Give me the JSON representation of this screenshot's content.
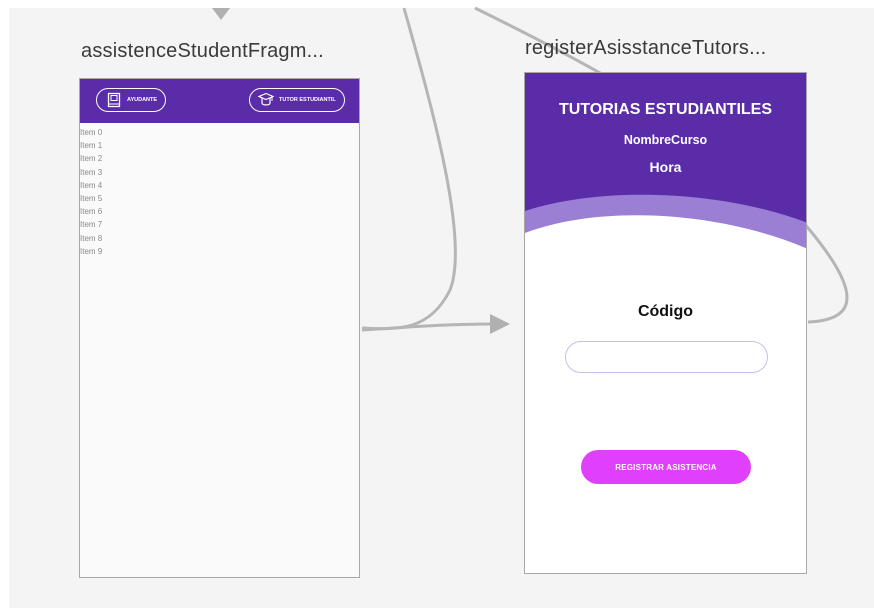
{
  "screens": [
    {
      "title": "assistenceStudentFragm...",
      "buttons": {
        "ayudante": "AYUDANTE",
        "tutor": "TUTOR ESTUDIANTIL"
      },
      "list_items": [
        "Item 0",
        "Item 1",
        "Item 2",
        "Item 3",
        "Item 4",
        "Item 5",
        "Item 6",
        "Item 7",
        "Item 8",
        "Item 9"
      ]
    },
    {
      "title": "registerAsisstanceTutors...",
      "header_title": "TUTORIAS ESTUDIANTILES",
      "course_name": "NombreCurso",
      "hour": "Hora",
      "code_label": "Código",
      "code_value": "",
      "register_button": "REGISTRAR ASISTENCIA"
    }
  ],
  "colors": {
    "primary_purple": "#5a2ca8",
    "wave_light": "#9b7fd4",
    "accent_pink": "#e040fb",
    "canvas_bg": "#f4f4f4",
    "connector": "#b5b5b5"
  },
  "icons": [
    "down-arrow-icon",
    "book-icon",
    "graduation-cap-icon",
    "right-arrow-icon"
  ]
}
